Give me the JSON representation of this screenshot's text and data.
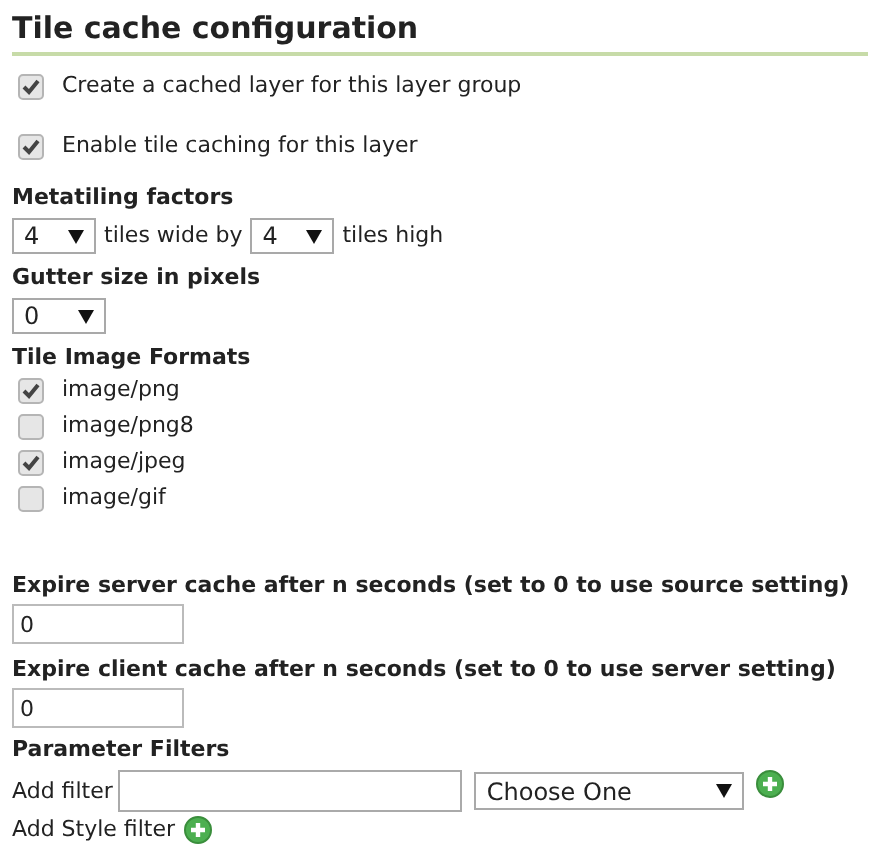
{
  "title": "Tile cache configuration",
  "options": [
    {
      "label": "Create a cached layer for this layer group",
      "checked": true
    },
    {
      "label": "Enable tile caching for this layer",
      "checked": true
    }
  ],
  "metatiling": {
    "label": "Metatiling factors",
    "wide": "4",
    "wide_label": "tiles wide by",
    "high": "4",
    "high_label": "tiles high"
  },
  "gutter": {
    "label": "Gutter size in pixels",
    "value": "0"
  },
  "formats": {
    "label": "Tile Image Formats",
    "items": [
      {
        "label": "image/png",
        "checked": true
      },
      {
        "label": "image/png8",
        "checked": false
      },
      {
        "label": "image/jpeg",
        "checked": true
      },
      {
        "label": "image/gif",
        "checked": false
      }
    ]
  },
  "expire_server": {
    "label": "Expire server cache after n seconds (set to 0 to use source setting)",
    "value": "0"
  },
  "expire_client": {
    "label": "Expire client cache after n seconds (set to 0 to use server setting)",
    "value": "0"
  },
  "parameter_filters": {
    "label": "Parameter Filters",
    "add_filter_label": "Add filter",
    "select": "Choose One",
    "add_style_label": "Add Style filter"
  }
}
